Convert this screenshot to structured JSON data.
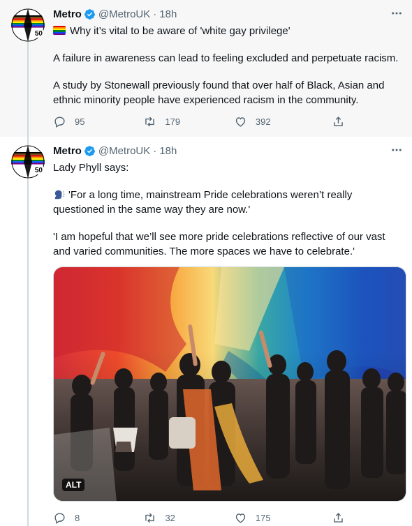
{
  "tweets": [
    {
      "author": "Metro",
      "handle": "@MetroUK",
      "separator": "·",
      "time": "18h",
      "avatar_badge": "50",
      "lines": [
        "Why it’s vital to be aware of 'white gay privilege'",
        "A failure in awareness can lead to feeling excluded and perpetuate racism.",
        "A study by Stonewall previously found that over half of Black, Asian and ethnic minority people have experienced racism in the community."
      ],
      "replies": "95",
      "retweets": "179",
      "likes": "392"
    },
    {
      "author": "Metro",
      "handle": "@MetroUK",
      "separator": "·",
      "time": "18h",
      "avatar_badge": "50",
      "lines": [
        "Lady Phyll says:",
        "'For a long time, mainstream Pride celebrations weren’t really questioned in the same way they are now.'",
        "'I am hopeful that we’ll see more pride celebrations reflective of our vast and varied communities. The more spaces we have to celebrate.'"
      ],
      "media_alt": "ALT",
      "replies": "8",
      "retweets": "32",
      "likes": "175"
    }
  ],
  "colors": {
    "verified": "#1d9bf0",
    "secondary_text": "#536471",
    "thread_line": "#cfd9de"
  },
  "icons": [
    "more-icon",
    "verified-badge-icon",
    "reply-icon",
    "retweet-icon",
    "like-icon",
    "share-icon",
    "rainbow-flag-icon",
    "speaking-head-icon"
  ]
}
